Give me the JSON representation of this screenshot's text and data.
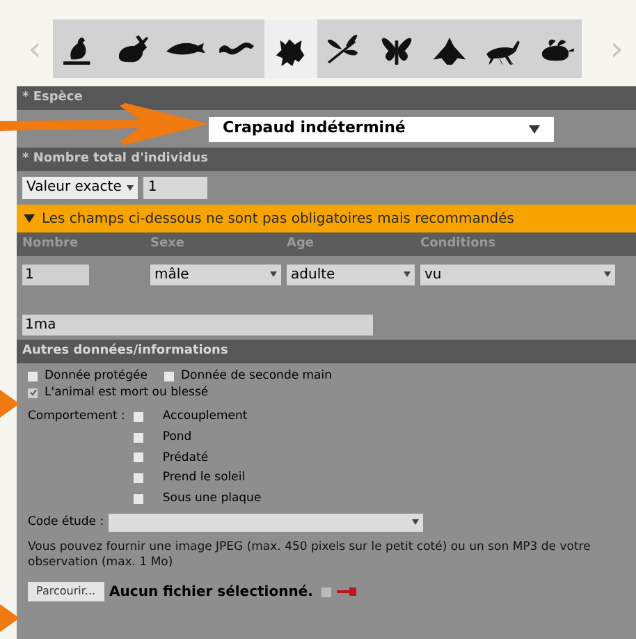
{
  "animal_tabs": [
    {
      "selected": false
    },
    {
      "selected": false
    },
    {
      "selected": false
    },
    {
      "selected": false
    },
    {
      "selected": true
    },
    {
      "selected": false
    },
    {
      "selected": false
    },
    {
      "selected": false
    },
    {
      "selected": false
    },
    {
      "selected": false
    }
  ],
  "nav": {
    "prev": "‹",
    "next": "›"
  },
  "species": {
    "header": "* Espèce",
    "value": "Crapaud indéterminé"
  },
  "count": {
    "header": "* Nombre total d'individus",
    "mode": "Valeur exacte",
    "value": "1"
  },
  "optional_banner": "Les champs ci-dessous ne sont pas obligatoires mais recommandés",
  "detail_table": {
    "columns": [
      "Nombre",
      "Sexe",
      "Age",
      "Conditions"
    ],
    "row": {
      "number": "1",
      "sex": "mâle",
      "age": "adulte",
      "condition": "vu"
    },
    "note_value": "1ma"
  },
  "other": {
    "header": "Autres données/informations",
    "flags": [
      {
        "label": "Donnée protégée",
        "checked": false
      },
      {
        "label": "Donnée de seconde main",
        "checked": false
      },
      {
        "label": "L'animal est mort ou blessé",
        "checked": true
      }
    ],
    "behaviour_label": "Comportement :",
    "behaviours": [
      {
        "label": "Accouplement",
        "checked": false
      },
      {
        "label": "Pond",
        "checked": false
      },
      {
        "label": "Prédaté",
        "checked": false
      },
      {
        "label": "Prend le soleil",
        "checked": false
      },
      {
        "label": "Sous une plaque",
        "checked": false
      }
    ],
    "study_code_label": "Code étude :",
    "upload_help": "Vous pouvez fournir une image JPEG (max. 450 pixels sur le petit coté) ou un son MP3 de votre observation (max. 1 Mo)",
    "browse_button": "Parcourir...",
    "file_status": "Aucun fichier sélectionné.",
    "attachment_checkbox": {
      "checked": false
    }
  }
}
